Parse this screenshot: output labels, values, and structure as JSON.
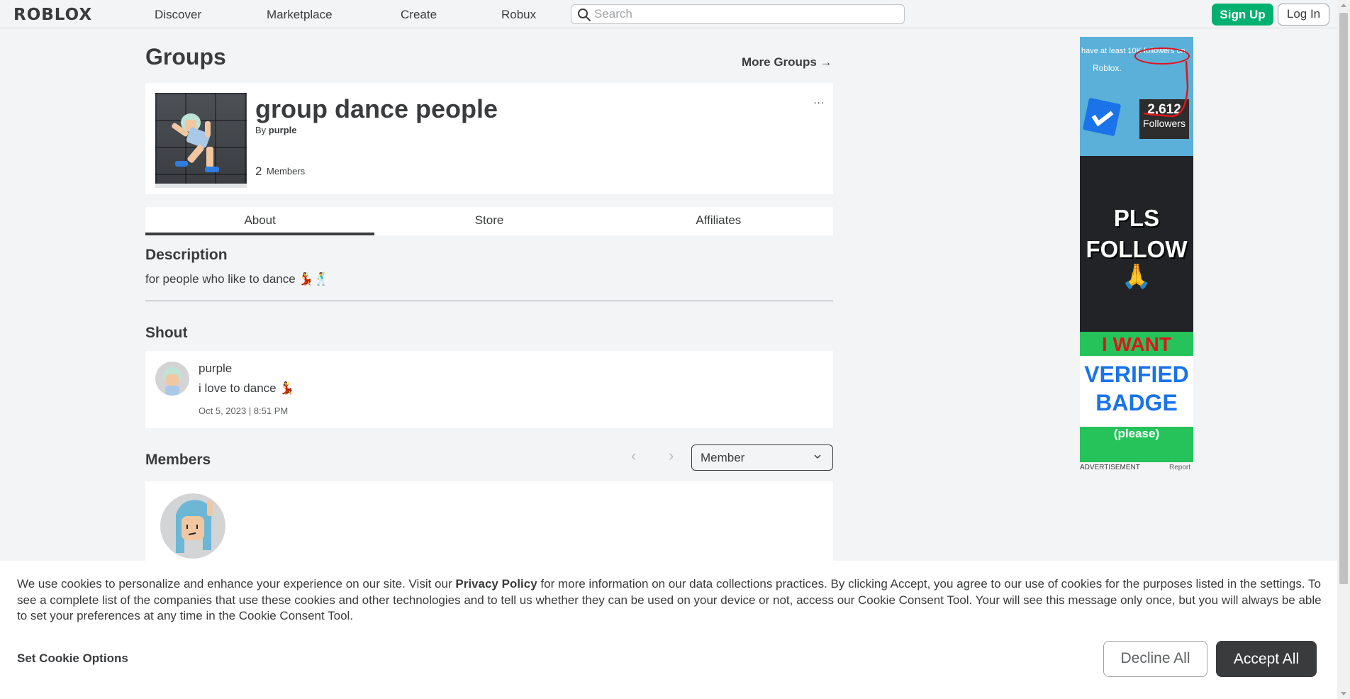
{
  "nav": {
    "logo": "ROBLOX",
    "links": [
      "Discover",
      "Marketplace",
      "Create",
      "Robux"
    ],
    "search_placeholder": "Search",
    "signup_label": "Sign Up",
    "login_label": "Log In"
  },
  "page": {
    "title": "Groups",
    "more_groups": "More Groups →"
  },
  "group": {
    "name": "group dance people",
    "by_prefix": "By",
    "owner": "purple",
    "members_count": "2",
    "members_label": "Members",
    "more_menu": "..."
  },
  "tabs": [
    "About",
    "Store",
    "Affiliates"
  ],
  "active_tab": "About",
  "description": {
    "title": "Description",
    "text": "for people who like to dance 💃🕺"
  },
  "shout": {
    "title": "Shout",
    "user": "purple",
    "text": "i love to dance 💃",
    "date": "Oct 5, 2023 | 8:51 PM"
  },
  "members": {
    "title": "Members",
    "prev_icon": "‹",
    "next_icon": "›",
    "role_selected": "Member"
  },
  "ad": {
    "top_line1": "have at least 10K followers on",
    "top_line2": "Roblox.",
    "followers_count": "2,612",
    "followers_label": "Followers",
    "pls_follow": "PLS\nFOLLOW",
    "pray": "🙏",
    "i_want": "I WANT",
    "verified_badge": "VERIFIED\nBADGE",
    "please": "(please)",
    "label": "ADVERTISEMENT",
    "report": "Report"
  },
  "cookie": {
    "text_before": "We use cookies to personalize and enhance your experience on our site. Visit our ",
    "privacy_link": "Privacy Policy",
    "text_after": " for more information on our data collections practices. By clicking Accept, you agree to our use of cookies for the purposes listed in the settings. To see a complete list of the companies that use these cookies and other technologies and to tell us whether they can be used on your device or not, access our Cookie Consent Tool. Your will see this message only once, but you will always be able to set your preferences at any time in the Cookie Consent Tool.",
    "set_options": "Set Cookie Options",
    "decline": "Decline All",
    "accept": "Accept All"
  },
  "colors": {
    "signup_green": "#00b06f",
    "accept_dark": "#393b3d",
    "page_bg": "#f2f4f5"
  }
}
